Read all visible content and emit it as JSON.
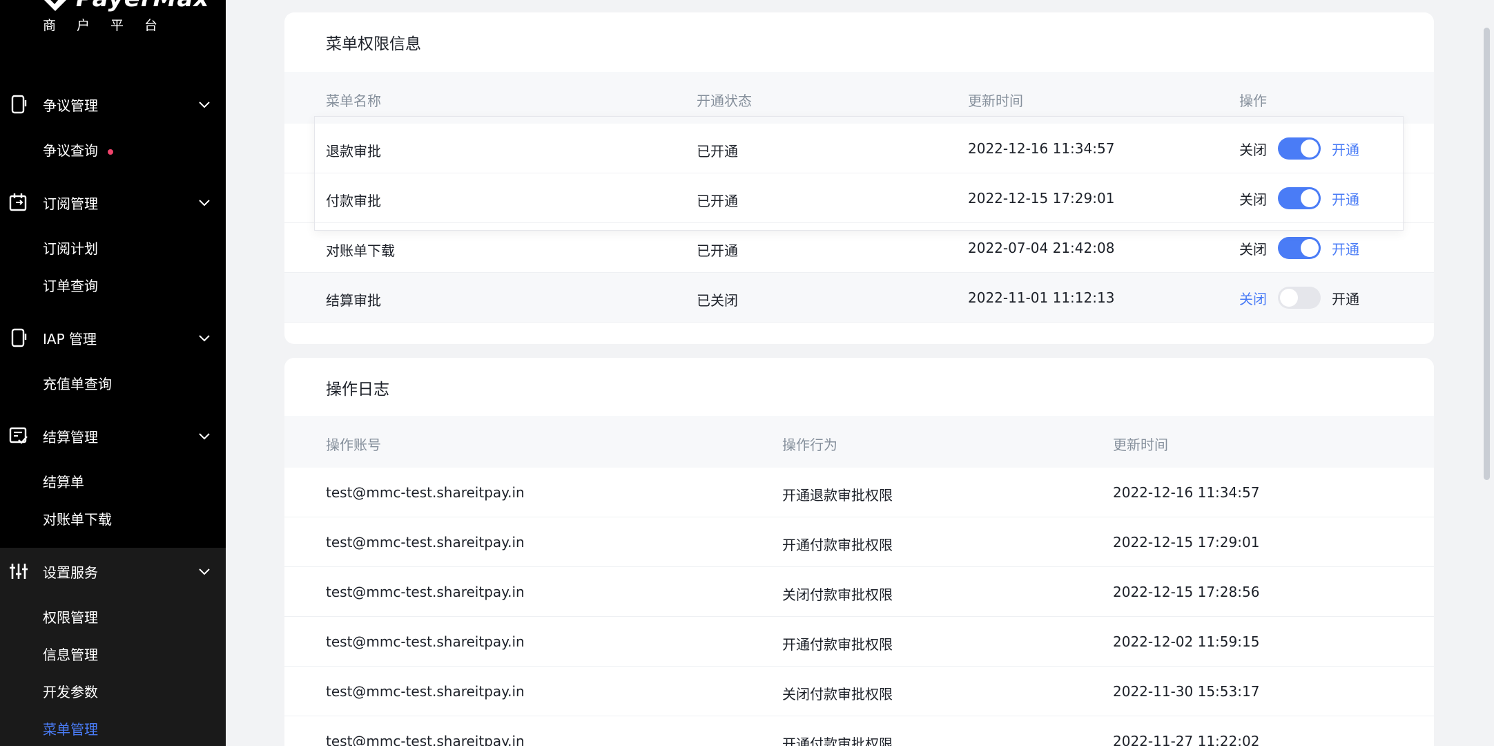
{
  "brand": {
    "name": "PayerMax",
    "subtitle": "商户平台"
  },
  "sidebar": {
    "groups": [
      {
        "label": "争议管理",
        "icon": "phone-icon",
        "items": [
          "争议查询"
        ]
      },
      {
        "label": "订阅管理",
        "icon": "calendar-icon",
        "items": [
          "订阅计划",
          "订单查询"
        ]
      },
      {
        "label": "IAP 管理",
        "icon": "phone-icon",
        "items": [
          "充值单查询"
        ]
      },
      {
        "label": "结算管理",
        "icon": "checklist-icon",
        "items": [
          "结算单",
          "对账单下载"
        ]
      },
      {
        "label": "设置服务",
        "icon": "sliders-icon",
        "items": [
          "权限管理",
          "信息管理",
          "开发参数",
          "菜单管理"
        ]
      }
    ],
    "active_item": "菜单管理"
  },
  "menu_permissions": {
    "title": "菜单权限信息",
    "headers": [
      "菜单名称",
      "开通状态",
      "更新时间",
      "操作"
    ],
    "off_label": "关闭",
    "on_label": "开通",
    "rows": [
      {
        "name": "退款审批",
        "status": "已开通",
        "time": "2022-12-16 11:34:57",
        "enabled": true
      },
      {
        "name": "付款审批",
        "status": "已开通",
        "time": "2022-12-15 17:29:01",
        "enabled": true
      },
      {
        "name": "对账单下载",
        "status": "已开通",
        "time": "2022-07-04 21:42:08",
        "enabled": true
      },
      {
        "name": "结算审批",
        "status": "已关闭",
        "time": "2022-11-01 11:12:13",
        "enabled": false
      }
    ]
  },
  "operation_log": {
    "title": "操作日志",
    "headers": [
      "操作账号",
      "操作行为",
      "更新时间"
    ],
    "rows": [
      {
        "account": "test@mmc-test.shareitpay.in",
        "action": "开通退款审批权限",
        "time": "2022-12-16 11:34:57"
      },
      {
        "account": "test@mmc-test.shareitpay.in",
        "action": "开通付款审批权限",
        "time": "2022-12-15 17:29:01"
      },
      {
        "account": "test@mmc-test.shareitpay.in",
        "action": "关闭付款审批权限",
        "time": "2022-12-15 17:28:56"
      },
      {
        "account": "test@mmc-test.shareitpay.in",
        "action": "开通付款审批权限",
        "time": "2022-12-02 11:59:15"
      },
      {
        "account": "test@mmc-test.shareitpay.in",
        "action": "关闭付款审批权限",
        "time": "2022-11-30 15:53:17"
      },
      {
        "account": "test@mmc-test.shareitpay.in",
        "action": "开通付款审批权限",
        "time": "2022-11-27 11:22:02"
      }
    ]
  },
  "colors": {
    "accent": "#4a7cf6",
    "sidebar_bg": "#000000",
    "notice_dot": "#f0436b"
  }
}
